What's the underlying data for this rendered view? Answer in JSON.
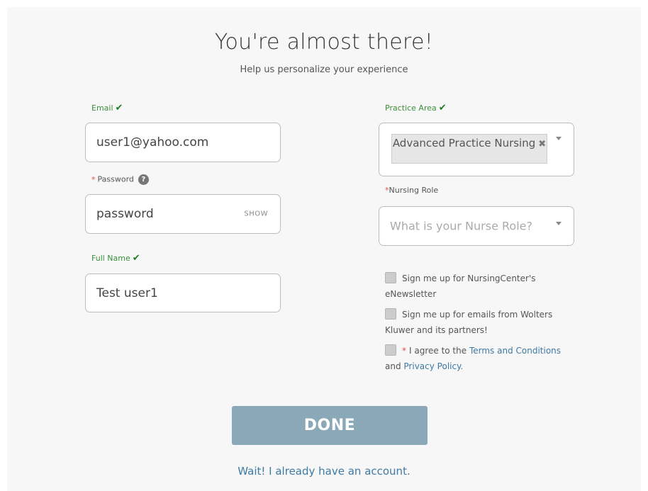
{
  "header": {
    "title": "You're almost there!",
    "subtitle": "Help us personalize your experience"
  },
  "form": {
    "email": {
      "label": "Email",
      "value": "user1@yahoo.com"
    },
    "password": {
      "label": "Password",
      "value": "password",
      "show_label": "SHOW",
      "help_glyph": "?"
    },
    "full_name": {
      "label": "Full Name",
      "value": "Test user1"
    },
    "practice_area": {
      "label": "Practice Area",
      "selected_tag": "Advanced Practice Nursing"
    },
    "nursing_role": {
      "label": "Nursing Role",
      "placeholder": "What is your Nurse Role?"
    },
    "checkboxes": {
      "newsletter": "Sign me up for NursingCenter's eNewsletter",
      "partner_emails": "Sign me up for emails from Wolters Kluwer and its partners!",
      "terms_prefix": "I agree to the",
      "terms_link": "Terms and Conditions",
      "and_text": "and",
      "privacy_link": "Privacy Policy."
    }
  },
  "actions": {
    "done_label": "DONE",
    "account_link": "Wait! I already have an account."
  },
  "colors": {
    "valid_green": "#3a8f3a",
    "required_red": "#d9534f",
    "link_blue": "#3e7aa3",
    "done_button": "#8aa8b8"
  },
  "icons": {
    "valid": "checkmark-icon",
    "help": "question-circle-icon",
    "remove": "close-icon",
    "dropdown": "caret-down-icon"
  }
}
